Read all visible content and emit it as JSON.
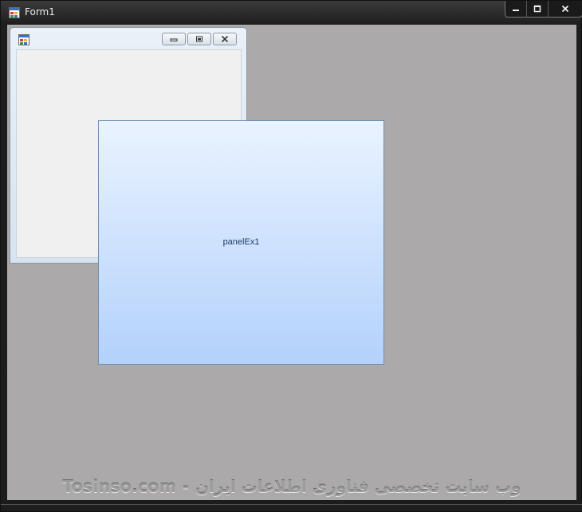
{
  "window": {
    "title": "Form1",
    "icons": {
      "app": "form-app-icon",
      "minimize": "minimize-icon",
      "maximize": "maximize-icon",
      "close": "close-icon"
    }
  },
  "mdi_child": {
    "icons": {
      "app": "form-app-icon",
      "minimize": "minimize-icon",
      "restore": "restore-icon",
      "close": "close-icon"
    }
  },
  "panel": {
    "label": "panelEx1"
  },
  "watermark": {
    "text": "Tosinso.com - وب سایت تخصصی فناوری اطلاعات ایران"
  },
  "colors": {
    "client_background": "#aba9aa",
    "panel_gradient_top": "#eaf3ff",
    "panel_gradient_bottom": "#b3d1fb",
    "panel_border": "#6d8fb6",
    "panel_text": "#1d3b69"
  }
}
